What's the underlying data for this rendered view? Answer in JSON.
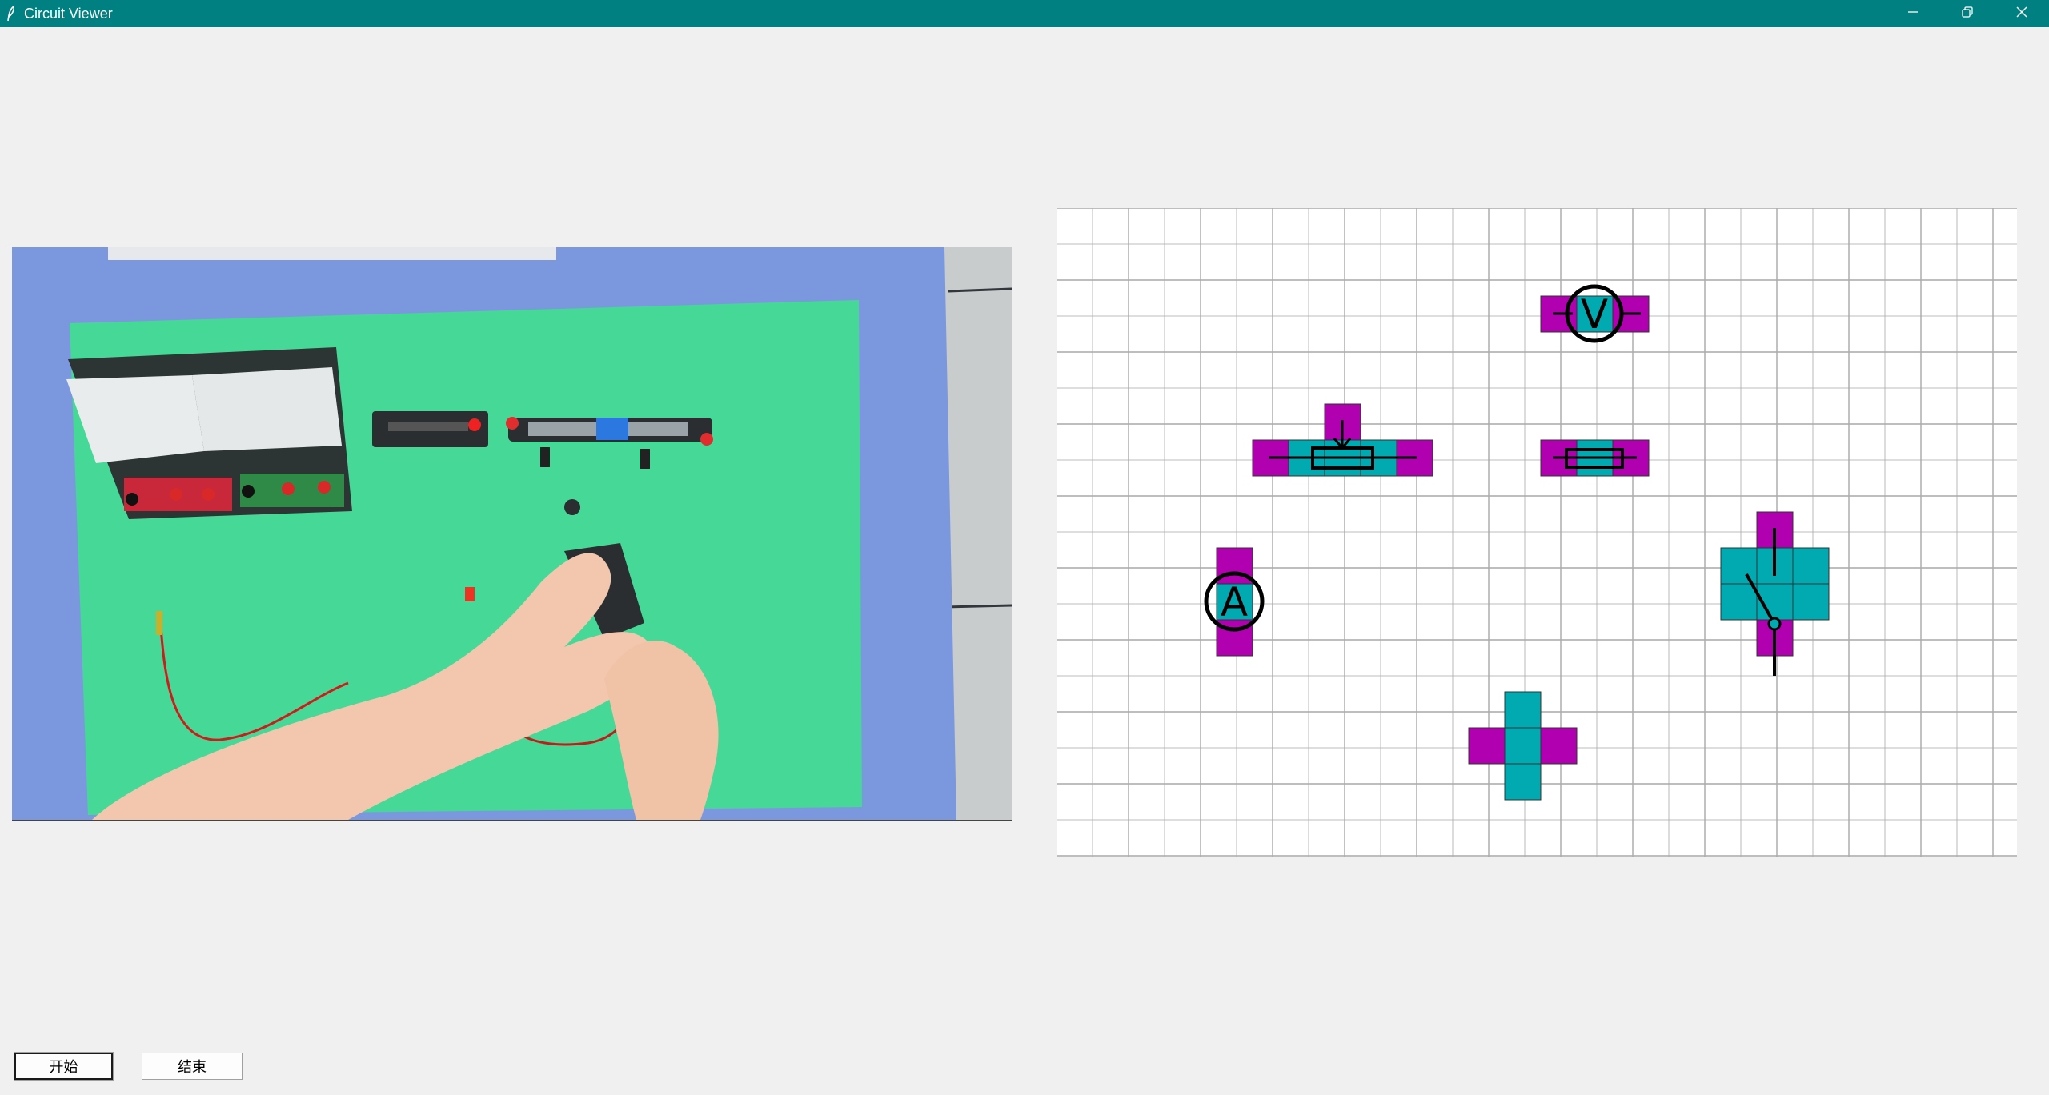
{
  "window": {
    "title": "Circuit Viewer",
    "titlebar_color": "#008080",
    "controls": [
      "minimize-icon",
      "restore-icon",
      "close-icon"
    ]
  },
  "camera": {
    "description_icon": "camera-frame"
  },
  "circuit": {
    "grid_color": "#a9a9a9",
    "terminal_color": "#b000b0",
    "body_color": "#00aab0",
    "components": [
      {
        "type": "voltmeter",
        "symbol": "V"
      },
      {
        "type": "rheostat"
      },
      {
        "type": "resistor"
      },
      {
        "type": "ammeter",
        "symbol": "A"
      },
      {
        "type": "switch"
      },
      {
        "type": "junction"
      }
    ]
  },
  "controls": {
    "start_label": "开始",
    "end_label": "结束"
  }
}
